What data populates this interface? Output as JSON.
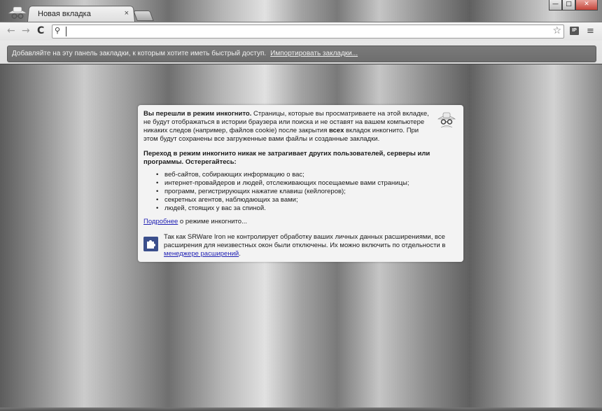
{
  "window": {
    "tab_title": "Новая вкладка",
    "tab_close": "×",
    "controls": {
      "minimize": "—",
      "maximize": "□",
      "close": "✕"
    }
  },
  "toolbar": {
    "back_icon": "←",
    "forward_icon": "→",
    "reload_icon": "C",
    "search_icon": "🔍",
    "address_value": "",
    "star_icon": "☆",
    "ip_button": "IP",
    "menu_icon": "≡"
  },
  "bookmarks_bar": {
    "message": "Добавляйте на эту панель закладки, к которым хотите иметь быстрый доступ.",
    "import_link": "Импортировать закладки..."
  },
  "incognito": {
    "intro_bold": "Вы перешли в режим инкогнито.",
    "intro_a": " Страницы, которые вы просматриваете на этой вкладке, не будут отображаться в истории браузера или поиска и не оставят на вашем компьютере никаких следов (например, файлов cookie) после закрытия ",
    "intro_all": "всех",
    "intro_b": " вкладок инкогнито. При этом будут сохранены все загруженные вами файлы и созданные закладки.",
    "warning": "Переход в режим инкогнито никак не затрагивает других пользователей, серверы или программы. Остерегайтесь:",
    "bullets": [
      "веб-сайтов, собирающих информацию о вас;",
      "интернет-провайдеров и людей, отслеживающих посещаемые вами страницы;",
      "программ, регистрирующих нажатие клавиш (кейлогеров);",
      "секретных агентов, наблюдающих за вами;",
      "людей, стоящих у вас за спиной."
    ],
    "more_link": "Подробнее",
    "more_suffix": " о режиме инкогнито...",
    "ext_text": "Так как SRWare Iron не контролирует обработку ваших личных данных расширениями, все расширения для неизвестных окон были отключены. Их можно включить по отдельности в ",
    "ext_link": "менеджере расширений",
    "ext_end": "."
  }
}
